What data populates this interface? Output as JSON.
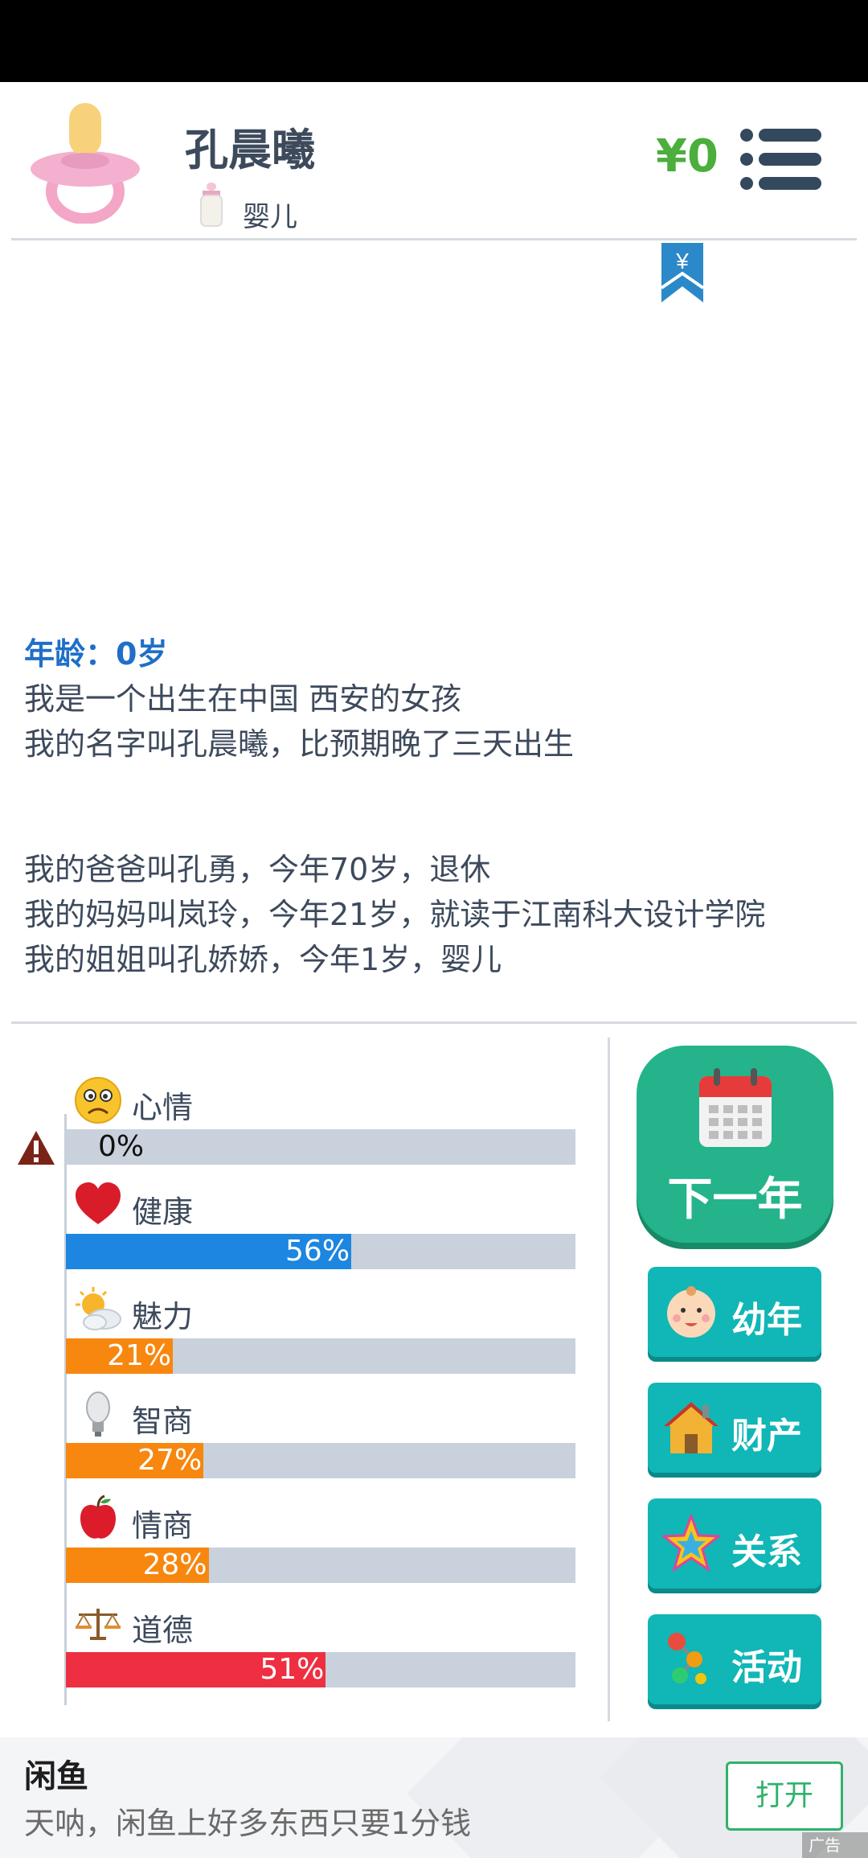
{
  "header": {
    "name": "孔晨曦",
    "stage": "婴儿",
    "money": "¥0",
    "bookmark_symbol": "¥"
  },
  "story": {
    "age_line": "年龄：0岁",
    "lines": [
      "我是一个出生在中国 西安的女孩",
      "我的名字叫孔晨曦，比预期晚了三天出生"
    ],
    "family": [
      "我的爸爸叫孔勇，今年70岁，退休",
      "我的妈妈叫岚玲，今年21岁，就读于江南科大设计学院",
      "我的姐姐叫孔娇娇，今年1岁，婴儿"
    ]
  },
  "stats": [
    {
      "label": "心情",
      "value": 0,
      "text": "0%",
      "color": "#c8d1dc",
      "icon": "sad-face-icon"
    },
    {
      "label": "健康",
      "value": 56,
      "text": "56%",
      "color": "#1c86e0",
      "icon": "heart-icon"
    },
    {
      "label": "魅力",
      "value": 21,
      "text": "21%",
      "color": "#f7870f",
      "icon": "sun-cloud-icon"
    },
    {
      "label": "智商",
      "value": 27,
      "text": "27%",
      "color": "#f7870f",
      "icon": "lightbulb-icon"
    },
    {
      "label": "情商",
      "value": 28,
      "text": "28%",
      "color": "#f7870f",
      "icon": "apple-icon"
    },
    {
      "label": "道德",
      "value": 51,
      "text": "51%",
      "color": "#ee2f42",
      "icon": "scales-icon"
    }
  ],
  "buttons": {
    "next_year": "下一年",
    "childhood": "幼年",
    "assets": "财产",
    "relations": "关系",
    "activities": "活动"
  },
  "ad": {
    "title": "闲鱼",
    "text": "天呐，闲鱼上好多东西只要1分钱",
    "button": "打开",
    "tag": "广告"
  },
  "colors": {
    "accent_green": "#24b38a",
    "button_teal": "#11b6b6",
    "money_green": "#4cae3c",
    "age_blue": "#1f6fc8"
  }
}
